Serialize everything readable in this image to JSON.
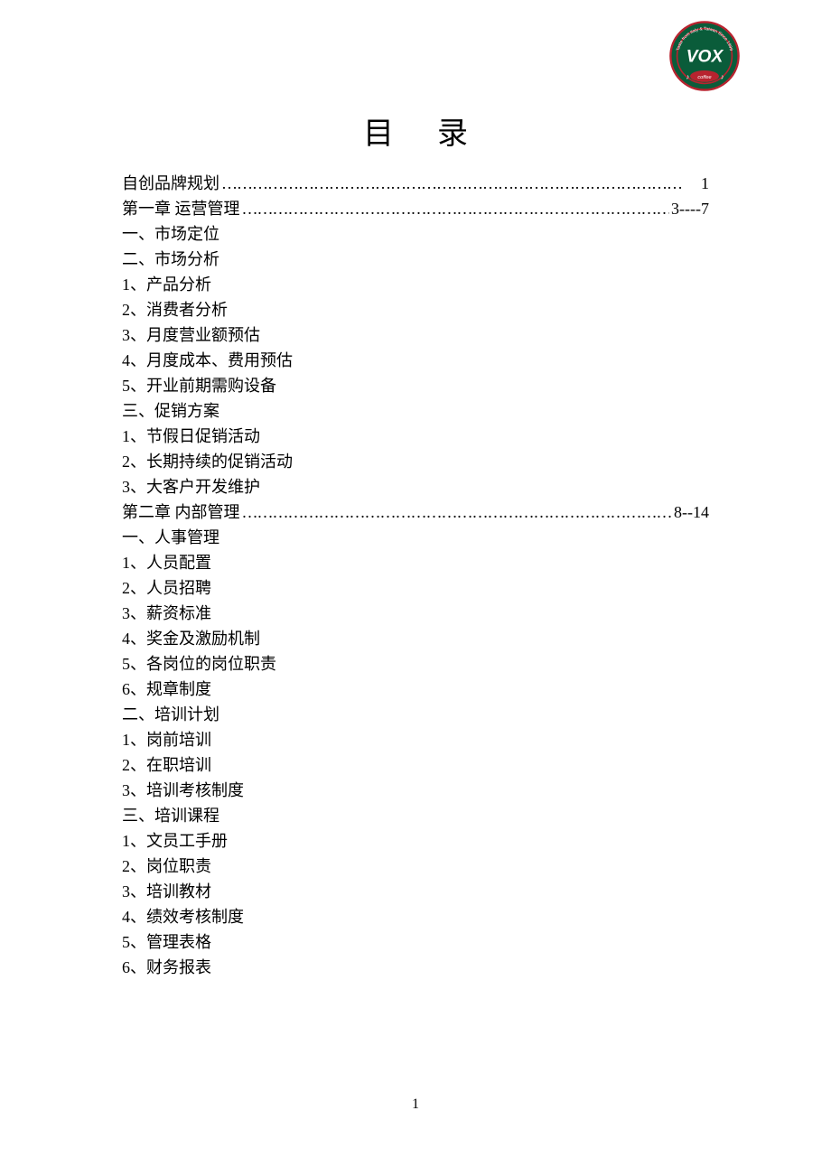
{
  "logo": {
    "text": "VOX",
    "subtext": "coffee",
    "ring_text_top": "Taste from Italy & Taiwan Since 1999",
    "bg_color": "#0a5c3a",
    "ring_color": "#b8232f",
    "text_color": "#ffffff"
  },
  "title": "目录",
  "dots": "………………………………………………………………………………",
  "sections": [
    {
      "type": "dotted",
      "label": "自创品牌规划",
      "page": "1"
    },
    {
      "type": "dotted",
      "label": "第一章 运营管理",
      "page": "3----7"
    },
    {
      "type": "plain",
      "text": "一、市场定位"
    },
    {
      "type": "plain",
      "text": "二、市场分析"
    },
    {
      "type": "plain",
      "text": "1、产品分析"
    },
    {
      "type": "plain",
      "text": "2、消费者分析"
    },
    {
      "type": "plain",
      "text": "3、月度营业额预估"
    },
    {
      "type": "plain",
      "text": "4、月度成本、费用预估"
    },
    {
      "type": "plain",
      "text": "5、开业前期需购设备"
    },
    {
      "type": "plain",
      "text": "三、促销方案"
    },
    {
      "type": "plain",
      "text": "1、节假日促销活动"
    },
    {
      "type": "plain",
      "text": "2、长期持续的促销活动"
    },
    {
      "type": "plain",
      "text": "3、大客户开发维护"
    },
    {
      "type": "dotted",
      "label": "第二章 内部管理",
      "page": "8--14"
    },
    {
      "type": "plain",
      "text": "一、人事管理"
    },
    {
      "type": "plain",
      "text": "1、人员配置"
    },
    {
      "type": "plain",
      "text": "2、人员招聘"
    },
    {
      "type": "plain",
      "text": "3、薪资标准"
    },
    {
      "type": "plain",
      "text": "4、奖金及激励机制"
    },
    {
      "type": "plain",
      "text": "5、各岗位的岗位职责"
    },
    {
      "type": "plain",
      "text": "6、规章制度"
    },
    {
      "type": "plain",
      "text": "二、培训计划"
    },
    {
      "type": "plain",
      "text": "1、岗前培训"
    },
    {
      "type": "plain",
      "text": "2、在职培训"
    },
    {
      "type": "plain",
      "text": "3、培训考核制度"
    },
    {
      "type": "plain",
      "text": "三、培训课程"
    },
    {
      "type": "plain",
      "text": "1、文员工手册"
    },
    {
      "type": "plain",
      "text": "2、岗位职责"
    },
    {
      "type": "plain",
      "text": "3、培训教材"
    },
    {
      "type": "plain",
      "text": "4、绩效考核制度"
    },
    {
      "type": "plain",
      "text": "5、管理表格"
    },
    {
      "type": "plain",
      "text": "6、财务报表"
    }
  ],
  "page_number": "1"
}
